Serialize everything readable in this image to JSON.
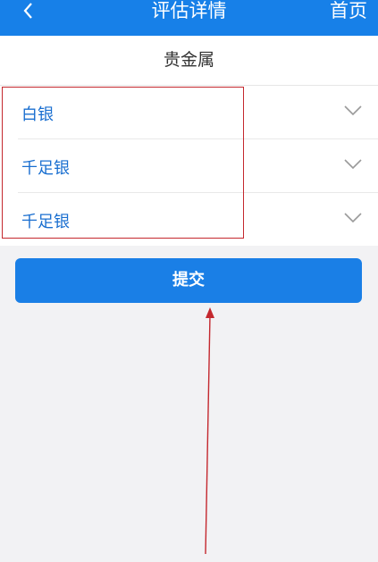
{
  "header": {
    "title": "评估详情",
    "home_label": "首页",
    "back_icon": "chevron-left-icon"
  },
  "section": {
    "title": "贵金属"
  },
  "rows": [
    {
      "label": "白银",
      "icon": "chevron-down-icon"
    },
    {
      "label": "千足银",
      "icon": "chevron-down-icon"
    },
    {
      "label": "千足银",
      "icon": "chevron-down-icon"
    }
  ],
  "submit": {
    "label": "提交"
  },
  "colors": {
    "primary": "#1780e8",
    "row_text": "#1a6fd0",
    "annotation": "#c4282e",
    "background": "#f2f2f4"
  }
}
